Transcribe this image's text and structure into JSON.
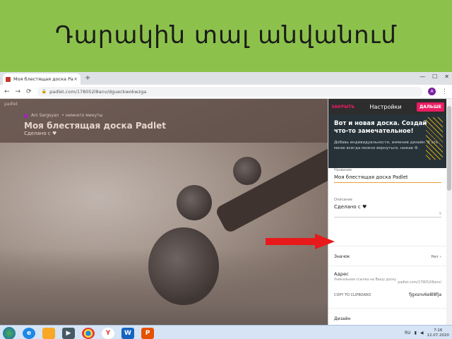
{
  "slide": {
    "title": "Դարակին տալ անվանում"
  },
  "browser": {
    "tab_title": "Моя блестящая доска Padlet",
    "tab_close": "×",
    "new_tab": "+",
    "win_min": "—",
    "win_max": "☐",
    "win_close": "✕",
    "back": "←",
    "forward": "→",
    "reload": "⟳",
    "url": "padlet.com/178052l8anv/dgueckwokwzga",
    "avatar_letter": "A",
    "menu": "⋮"
  },
  "padlet": {
    "brand": "padlet",
    "author": "Ani Sargsyan",
    "time": "• немного минуты",
    "title": "Моя блестящая доска Padlet",
    "subtitle": "Сделано с ♥"
  },
  "settings": {
    "close_label": "ЗАКРЫТЬ",
    "title": "Настройки",
    "next_label": "ДАЛЬШЕ",
    "banner_title": "Вот и новая доска. Создай что-то замечательное!",
    "banner_desc": "Добавь индивидуальности, изменив дизайн. В это меню всегда можно вернуться, нажав ⚙.",
    "name_label": "Название",
    "name_value": "Моя блестящая доска Padlet",
    "desc_label": "Описание",
    "desc_value": "Сделано с ♥",
    "desc_count": "5",
    "icon_label": "Значок",
    "icon_value": "Нет",
    "address_title": "Адрес",
    "address_desc": "Уникальная ссылка на Вашу доску",
    "address_url": "padlet.com/178052l8anv/",
    "copy_label": "COPY TO CLIPBOARD",
    "slug": "fjgxsnv6e8l8fja",
    "design_label": "Дизайн"
  },
  "taskbar": {
    "lang": "RU",
    "time": "7:16",
    "date": "12.07.2020"
  }
}
